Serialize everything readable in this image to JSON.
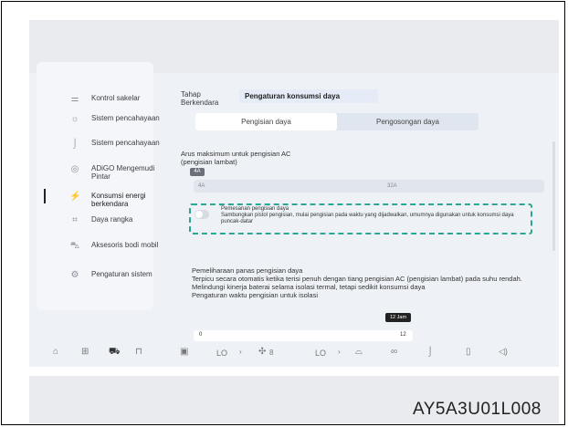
{
  "sidebar": {
    "items": [
      {
        "label": "Kontrol sakelar",
        "icon": "switch-icon"
      },
      {
        "label": "Sistem pencahayaan",
        "icon": "light-icon"
      },
      {
        "label": "Sistem pencahayaan",
        "icon": "ambient-light-icon"
      },
      {
        "label": "ADiGO Mengemudi Pintar",
        "icon": "steering-icon"
      },
      {
        "label": "Konsumsi energi berkendara",
        "icon": "energy-icon"
      },
      {
        "label": "Daya rangka",
        "icon": "chassis-icon"
      },
      {
        "label": "Aksesoris bodi mobil",
        "icon": "car-body-icon"
      },
      {
        "label": "Pengaturan sistem",
        "icon": "gear-icon"
      }
    ]
  },
  "header": {
    "step_label": "Tahap Berkendara",
    "title": "Pengaturan konsumsi daya"
  },
  "tabs": [
    "Pengisian daya",
    "Pengosongan daya"
  ],
  "charge_current": {
    "label": "Arus maksimum untuk pengisian AC (pengisian lambat)",
    "thumb": "4A",
    "min": "4A",
    "max": "32A"
  },
  "reservation": {
    "title": "Pemesanan pengisian daya",
    "desc": "Sambungkan pistol pengisian, mulai pengisian pada waktu yang dijadwalkan, umumnya digunakan untuk konsumsi daya puncak-datar"
  },
  "heating": {
    "title": "Pemeliharaan panas pengisian daya",
    "desc": "Terpicu secara otomatis ketika terisi penuh dengan tiang pengisian AC (pengisian lambat) pada suhu rendah. Melindungi kinerja baterai selama isolasi termal, tetapi sedikit konsumsi daya",
    "sub": "Pengaturan waktu pengisian untuk isolasi",
    "bubble": "12 Jam",
    "min": "0",
    "max": "12",
    "value_hours": 12
  },
  "dock": {
    "temp_left": "LO",
    "fan": "8",
    "temp_right": "LO"
  },
  "code": "AY5A3U01L008"
}
